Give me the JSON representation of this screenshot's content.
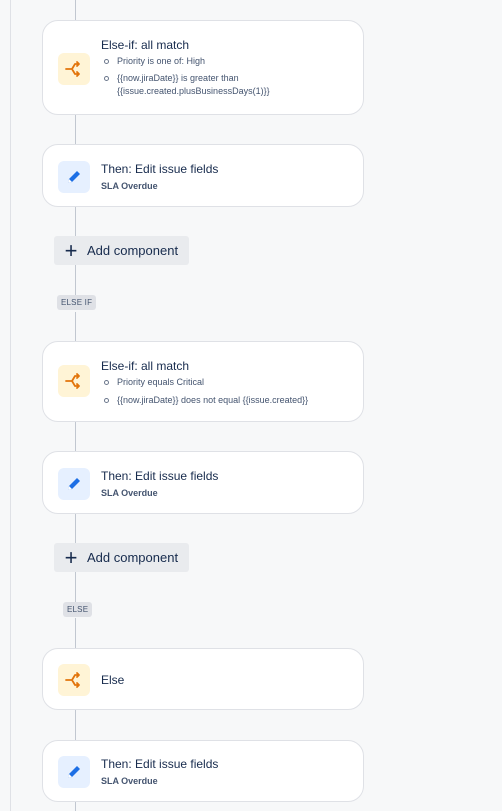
{
  "colors": {
    "condition_icon": "#e2740b",
    "action_icon": "#1d6fe5"
  },
  "blocks": [
    {
      "type": "condition",
      "icon": "branch-icon",
      "title": "Else-if: all match",
      "conditions": [
        {
          "lines": [
            "Priority is one of: High"
          ]
        },
        {
          "lines": [
            "{{now.jiraDate}} is greater than",
            "{{issue.created.plusBusinessDays(1)}}"
          ]
        }
      ]
    },
    {
      "type": "action",
      "icon": "pencil-icon",
      "title": "Then: Edit issue fields",
      "subtitle": "SLA Overdue"
    },
    {
      "type": "add",
      "label": "Add component"
    },
    {
      "type": "lozenge",
      "label": "ELSE IF"
    },
    {
      "type": "condition",
      "icon": "branch-icon",
      "title": "Else-if: all match",
      "conditions": [
        {
          "lines": [
            "Priority equals Critical"
          ]
        },
        {
          "lines": [
            "{{now.jiraDate}} does not equal {{issue.created}}"
          ]
        }
      ]
    },
    {
      "type": "action",
      "icon": "pencil-icon",
      "title": "Then: Edit issue fields",
      "subtitle": "SLA Overdue"
    },
    {
      "type": "add",
      "label": "Add component"
    },
    {
      "type": "lozenge",
      "label": "ELSE"
    },
    {
      "type": "condition",
      "icon": "branch-icon",
      "title": "Else"
    },
    {
      "type": "action",
      "icon": "pencil-icon",
      "title": "Then: Edit issue fields",
      "subtitle": "SLA Overdue"
    }
  ]
}
